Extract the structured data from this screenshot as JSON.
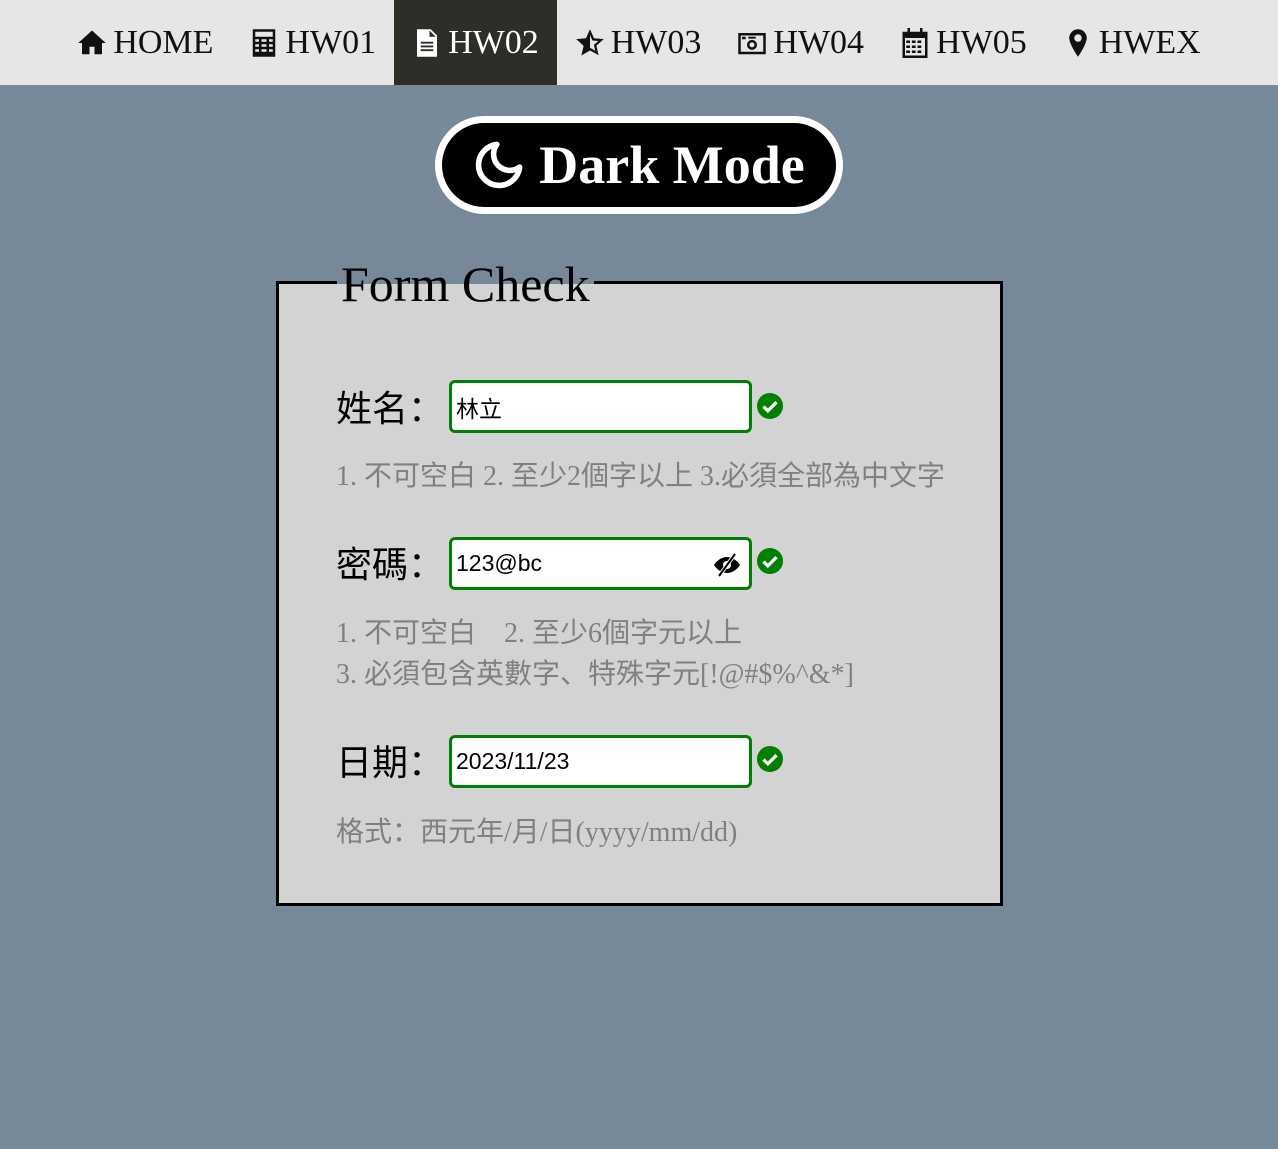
{
  "nav": {
    "items": [
      {
        "label": "HOME",
        "icon": "home-icon"
      },
      {
        "label": "HW01",
        "icon": "calculator-icon"
      },
      {
        "label": "HW02",
        "icon": "document-icon",
        "active": true
      },
      {
        "label": "HW03",
        "icon": "star-icon"
      },
      {
        "label": "HW04",
        "icon": "camera-icon"
      },
      {
        "label": "HW05",
        "icon": "calendar-icon"
      },
      {
        "label": "HWEX",
        "icon": "map-marker-icon"
      }
    ]
  },
  "dark_mode": {
    "label": "Dark Mode",
    "icon": "moon-icon"
  },
  "form": {
    "legend": "Form Check",
    "name": {
      "label": "姓名：",
      "value": "林立",
      "hint": "1. 不可空白 2. 至少2個字以上 3.必須全部為中文字",
      "valid": true
    },
    "password": {
      "label": "密碼：",
      "value": "123@bc",
      "hint_line1": "1. 不可空白　2. 至少6個字元以上",
      "hint_line2": "3. 必須包含英數字、特殊字元[!@#$%^&*]",
      "valid": true
    },
    "date": {
      "label": "日期：",
      "value": "2023/11/23",
      "hint": "格式：西元年/月/日(yyyy/mm/dd)",
      "valid": true
    }
  },
  "colors": {
    "background": "#778899",
    "nav_background": "#e6e6e6",
    "nav_active": "#2e2e29",
    "form_background": "#d3d3d3",
    "valid_green": "#008000",
    "hint_gray": "#808080"
  }
}
